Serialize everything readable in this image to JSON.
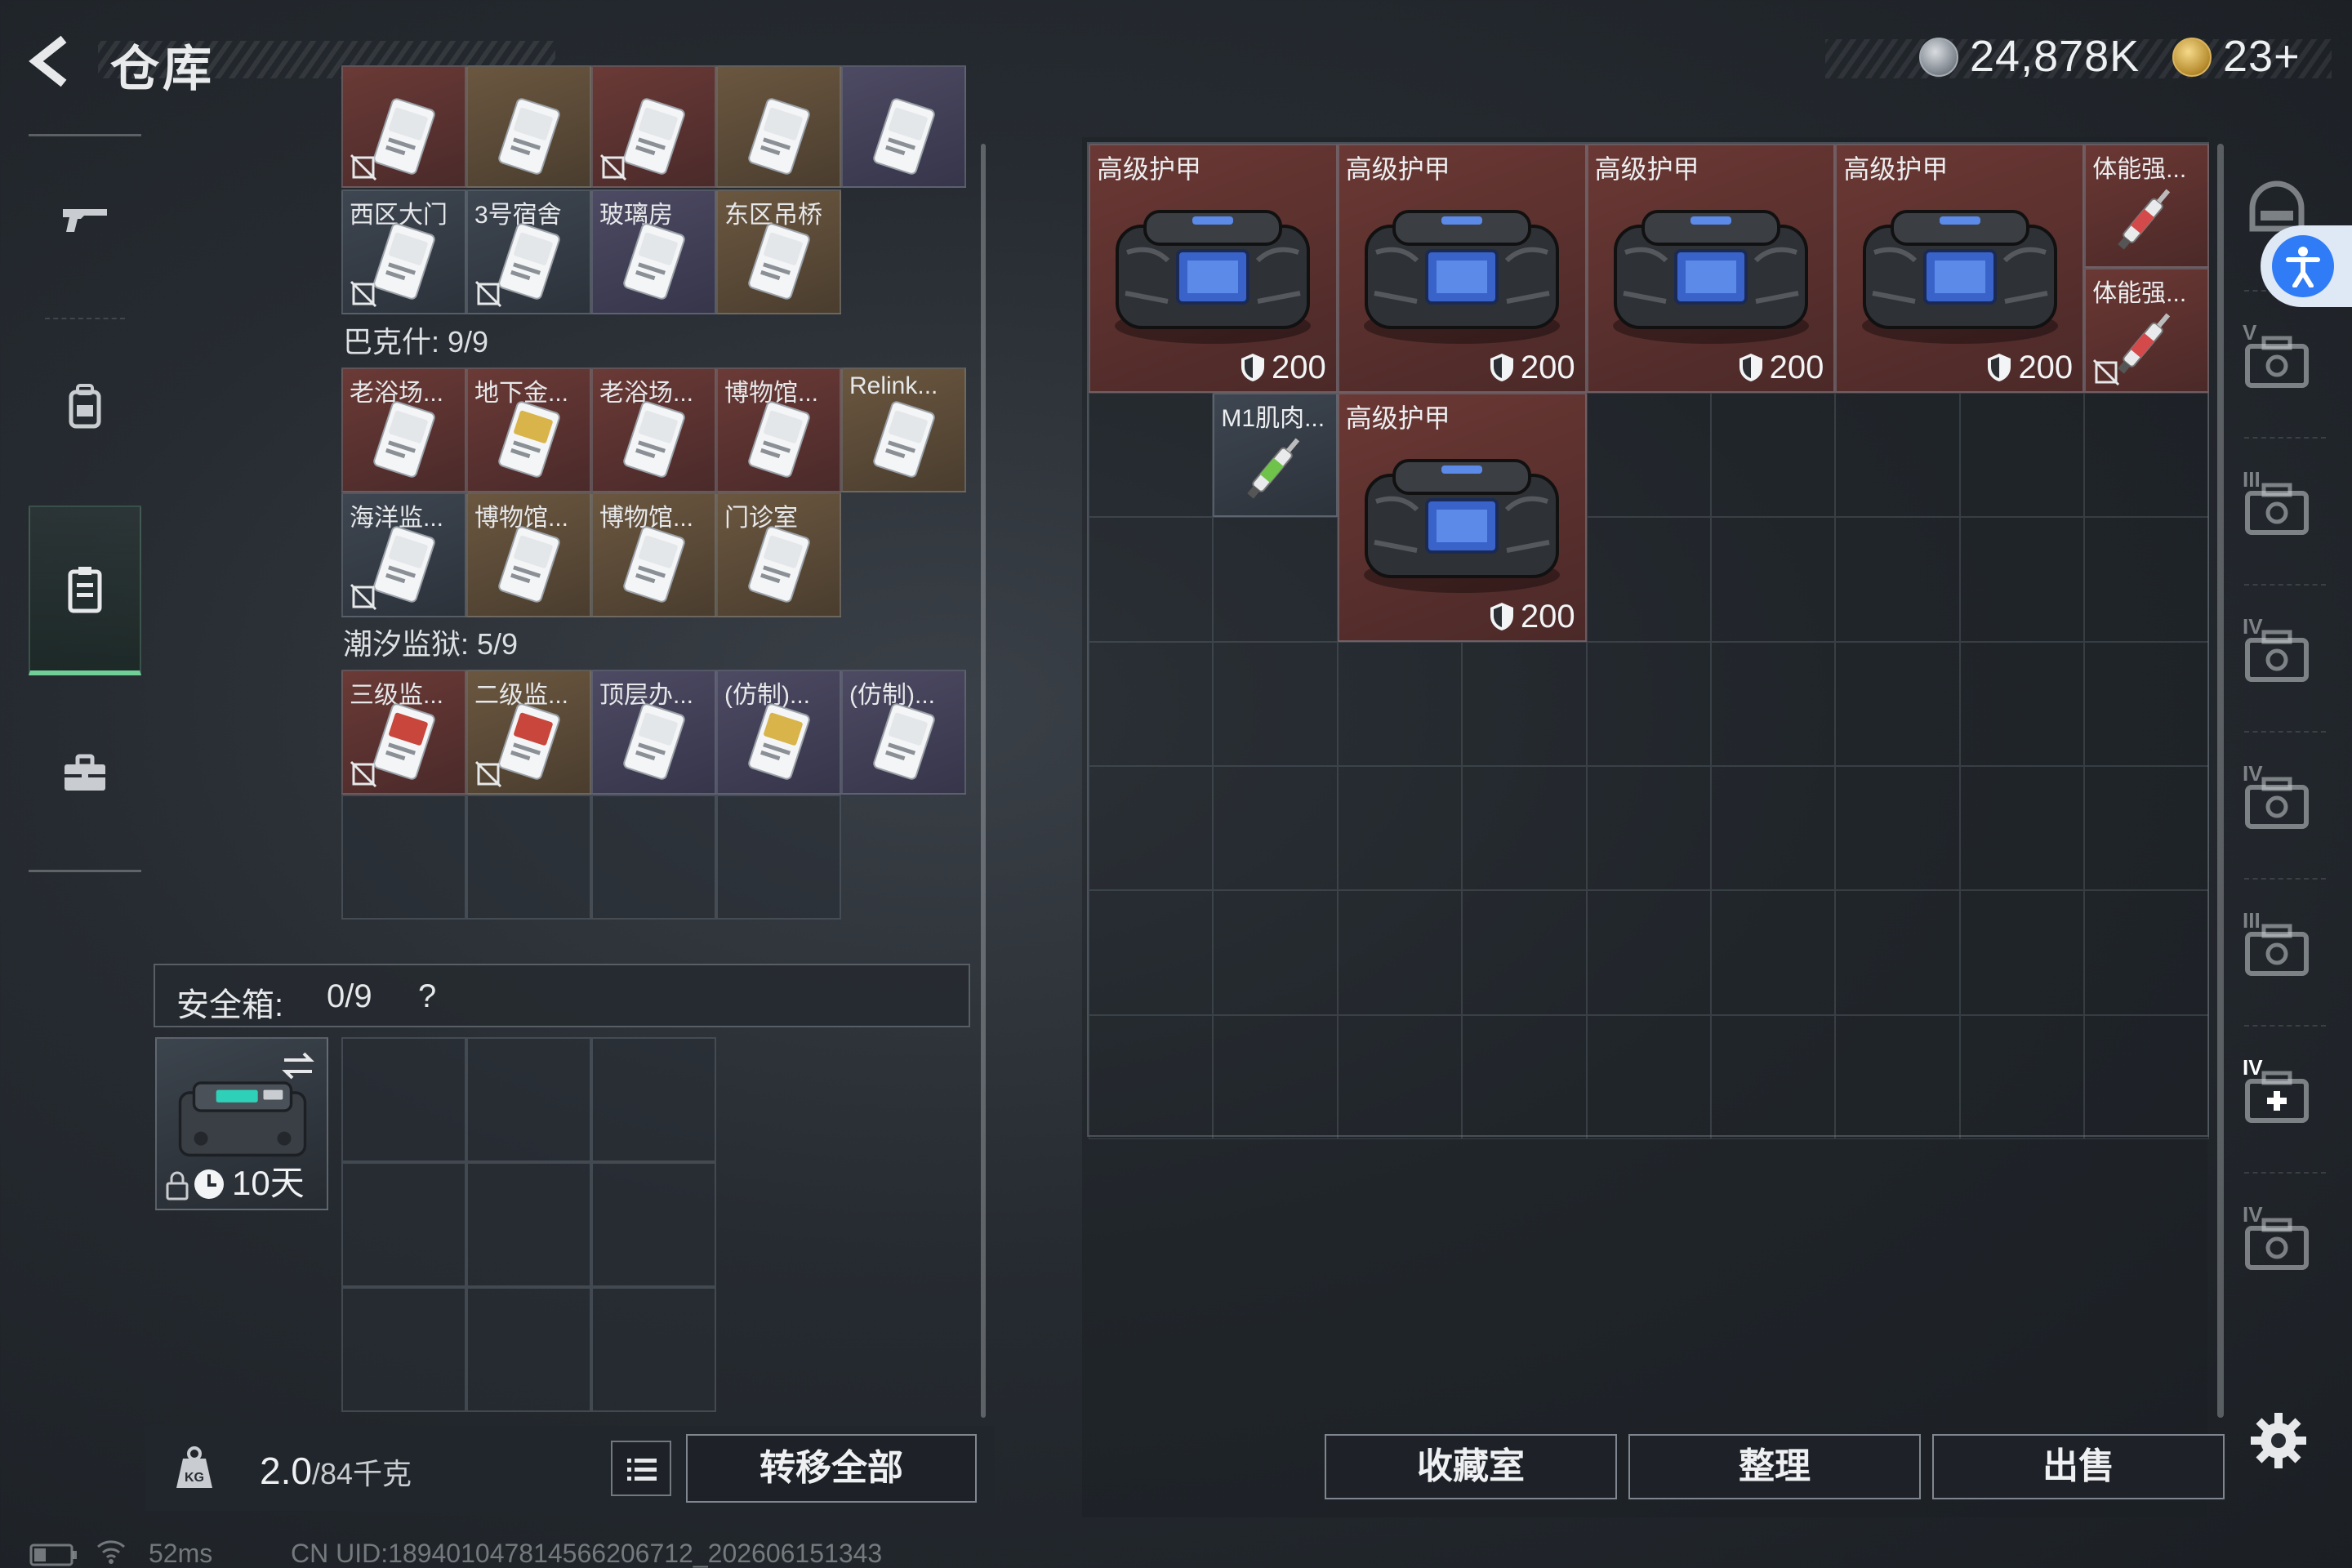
{
  "header": {
    "title": "仓库",
    "currency": {
      "silver_amount": "24,878K",
      "gold_amount": "23+"
    }
  },
  "left_nav": {
    "items": [
      {
        "name": "firearms",
        "icon": "gun-icon"
      },
      {
        "name": "equipment",
        "icon": "backpack-icon"
      },
      {
        "name": "keycards",
        "icon": "keycard-holder-icon",
        "active": true
      },
      {
        "name": "tools",
        "icon": "briefcase-icon"
      }
    ]
  },
  "storage": {
    "partial_row_top": {
      "tiers": [
        "red",
        "gold",
        "red",
        "gold",
        "purple"
      ],
      "no_sale": [
        true,
        false,
        true,
        false,
        false
      ]
    },
    "group1_row2": [
      {
        "label": "西区大门",
        "tier": "grey",
        "no_sale": true
      },
      {
        "label": "3号宿舍",
        "tier": "grey",
        "no_sale": true
      },
      {
        "label": "玻璃房",
        "tier": "purple",
        "no_sale": false
      },
      {
        "label": "东区吊桥",
        "tier": "gold",
        "no_sale": false
      }
    ],
    "sections": [
      {
        "title": "巴克什: 9/9",
        "rows": [
          [
            {
              "label": "老浴场...",
              "tier": "red",
              "no_sale": false
            },
            {
              "label": "地下金...",
              "tier": "red",
              "no_sale": false,
              "card": "gold"
            },
            {
              "label": "老浴场...",
              "tier": "red",
              "no_sale": false
            },
            {
              "label": "博物馆...",
              "tier": "red",
              "no_sale": false
            },
            {
              "label": "Relink...",
              "tier": "gold",
              "no_sale": false
            }
          ],
          [
            {
              "label": "海洋监...",
              "tier": "grey",
              "no_sale": true
            },
            {
              "label": "博物馆...",
              "tier": "gold",
              "no_sale": false
            },
            {
              "label": "博物馆...",
              "tier": "gold",
              "no_sale": false
            },
            {
              "label": "门诊室",
              "tier": "gold",
              "no_sale": false
            }
          ]
        ]
      },
      {
        "title": "潮汐监狱: 5/9",
        "rows": [
          [
            {
              "label": "三级监...",
              "tier": "red",
              "no_sale": true,
              "card": "red"
            },
            {
              "label": "二级监...",
              "tier": "gold",
              "no_sale": true,
              "card": "red"
            },
            {
              "label": "顶层办...",
              "tier": "purple",
              "no_sale": false
            },
            {
              "label": "(仿制)...",
              "tier": "purple",
              "no_sale": false,
              "card": "gold"
            },
            {
              "label": "(仿制)...",
              "tier": "purple",
              "no_sale": false
            }
          ]
        ]
      }
    ],
    "safe_box": {
      "label": "安全箱:",
      "count": "0/9",
      "help": "?",
      "days_left": "10天"
    },
    "weight": {
      "current": "2.0",
      "capacity": "/84千克"
    },
    "transfer_all": "转移全部"
  },
  "inventory": {
    "armors": [
      {
        "label": "高级护甲",
        "durability": "200"
      },
      {
        "label": "高级护甲",
        "durability": "200"
      },
      {
        "label": "高级护甲",
        "durability": "200"
      },
      {
        "label": "高级护甲",
        "durability": "200"
      },
      {
        "label": "高级护甲",
        "durability": "200"
      }
    ],
    "consumables": [
      {
        "label": "体能强...",
        "no_sale": false
      },
      {
        "label": "体能强...",
        "no_sale": true
      },
      {
        "label": "M1肌肉...",
        "no_sale": false
      }
    ],
    "buttons": {
      "collection": "收藏室",
      "organize": "整理",
      "sell": "出售"
    }
  },
  "right_rail": {
    "items": [
      {
        "label": "",
        "icon": "helmet-icon"
      },
      {
        "label": "V",
        "icon": "case-tier-v-icon"
      },
      {
        "label": "III",
        "icon": "case-tier-iii-icon"
      },
      {
        "label": "IV",
        "icon": "crate-tier-iv-icon"
      },
      {
        "label": "IV",
        "icon": "crate-tier-iv-icon"
      },
      {
        "label": "III",
        "icon": "rack-tier-iii-icon"
      },
      {
        "label": "IV",
        "icon": "medical-case-tier-iv-icon"
      },
      {
        "label": "IV",
        "icon": "case-tier-iv-icon"
      }
    ]
  },
  "status_bar": {
    "ping": "52ms",
    "uid": "CN UID:18940104781456620671​2_202606151343"
  }
}
